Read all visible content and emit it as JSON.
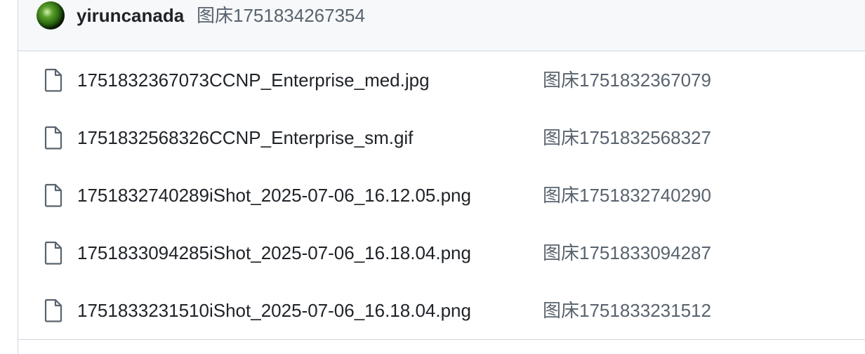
{
  "latest_commit": {
    "author": "yiruncanada",
    "message": "图床1751834267354"
  },
  "files": [
    {
      "name": "1751832367073CCNP_Enterprise_med.jpg",
      "commit_message": "图床1751832367079",
      "icon": "file-icon"
    },
    {
      "name": "1751832568326CCNP_Enterprise_sm.gif",
      "commit_message": "图床1751832568327",
      "icon": "file-icon"
    },
    {
      "name": "1751832740289iShot_2025-07-06_16.12.05.png",
      "commit_message": "图床1751832740290",
      "icon": "file-icon"
    },
    {
      "name": "1751833094285iShot_2025-07-06_16.18.04.png",
      "commit_message": "图床1751833094287",
      "icon": "file-icon"
    },
    {
      "name": "1751833231510iShot_2025-07-06_16.18.04.png",
      "commit_message": "图床1751833231512",
      "icon": "file-icon"
    }
  ]
}
